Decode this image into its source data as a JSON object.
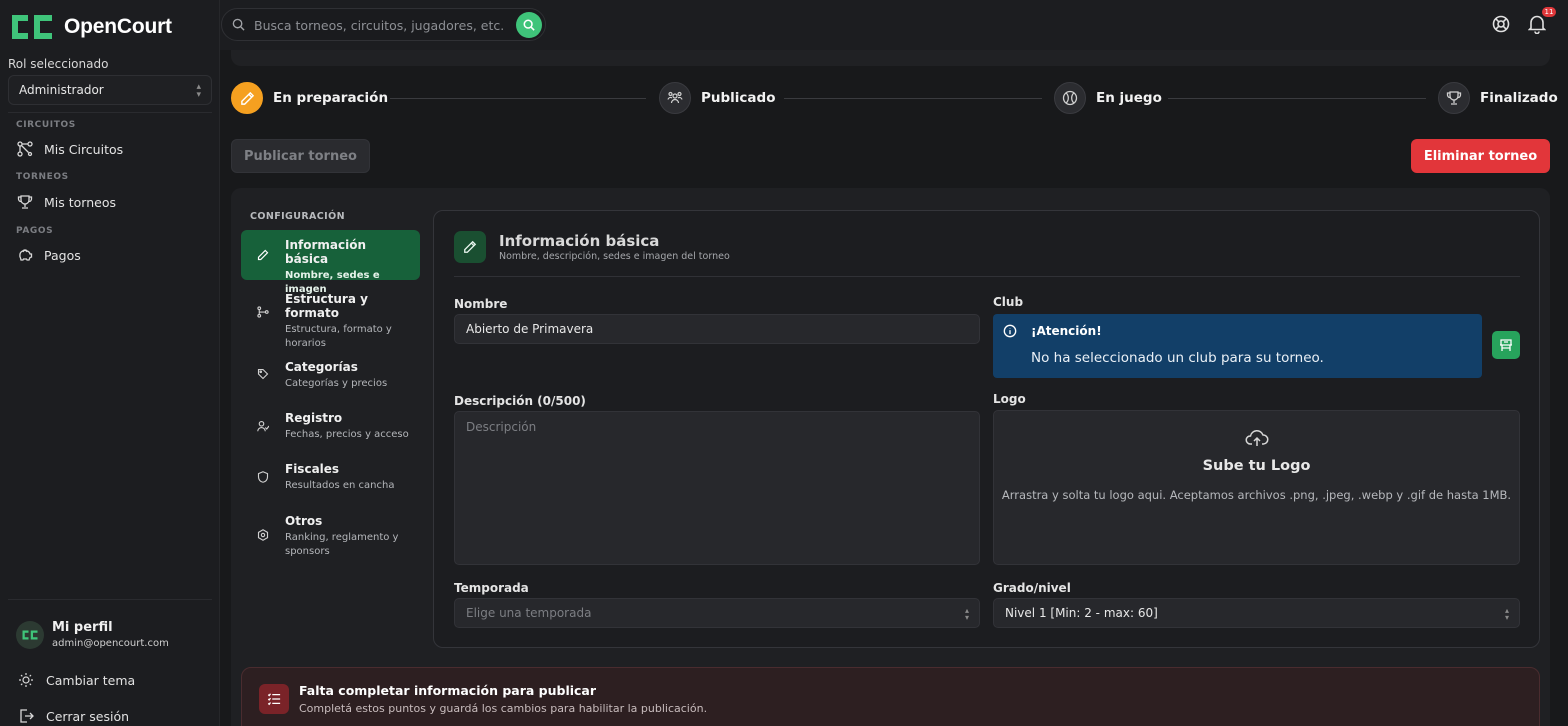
{
  "app": {
    "name": "OpenCourt"
  },
  "sidebar": {
    "role_label": "Rol seleccionado",
    "role_value": "Administrador",
    "sections": [
      {
        "title": "CIRCUITOS",
        "item": "Mis Circuitos",
        "icon": "circuit-icon"
      },
      {
        "title": "TORNEOS",
        "item": "Mis torneos",
        "icon": "trophy-icon"
      },
      {
        "title": "PAGOS",
        "item": "Pagos",
        "icon": "piggy-bank-icon"
      }
    ],
    "profile": {
      "name": "Mi perfil",
      "email": "admin@opencourt.com"
    },
    "change_theme": "Cambiar tema",
    "logout": "Cerrar sesión"
  },
  "topbar": {
    "search_placeholder": "Busca torneos, circuitos, jugadores, etc.",
    "notification_count": "11"
  },
  "steps": [
    {
      "label": "En preparación",
      "icon": "pencil-icon",
      "active": true
    },
    {
      "label": "Publicado",
      "icon": "people-icon",
      "active": false
    },
    {
      "label": "En juego",
      "icon": "ball-icon",
      "active": false
    },
    {
      "label": "Finalizado",
      "icon": "trophy-icon",
      "active": false
    }
  ],
  "actions": {
    "publish": "Publicar torneo",
    "delete": "Eliminar torneo"
  },
  "config": {
    "title": "CONFIGURACIÓN",
    "items": [
      {
        "title": "Información básica",
        "desc": "Nombre, sedes e imagen"
      },
      {
        "title": "Estructura y formato",
        "desc": "Estructura, formato y horarios"
      },
      {
        "title": "Categorías",
        "desc": "Categorías y precios"
      },
      {
        "title": "Registro",
        "desc": "Fechas, precios y acceso"
      },
      {
        "title": "Fiscales",
        "desc": "Resultados en cancha"
      },
      {
        "title": "Otros",
        "desc": "Ranking, reglamento y sponsors"
      }
    ]
  },
  "card": {
    "title": "Información básica",
    "subtitle": "Nombre, descripción, sedes e imagen del torneo",
    "name_label": "Nombre",
    "name_value": "Abierto de Primavera",
    "club_label": "Club",
    "alert_title": "¡Atención!",
    "alert_message": "No ha seleccionado un club para su torneo.",
    "desc_label": "Descripción (0/500)",
    "desc_placeholder": "Descripción",
    "logo_label": "Logo",
    "logo_title": "Sube tu Logo",
    "logo_desc": "Arrastra y solta tu logo aqui. Aceptamos archivos .png, .jpeg, .webp y .gif de hasta 1MB.",
    "season_label": "Temporada",
    "season_placeholder": "Elige una temporada",
    "level_label": "Grado/nivel",
    "level_value": "Nivel 1 [Min: 2 - max: 60]"
  },
  "warning": {
    "title": "Falta completar información para publicar",
    "desc": "Completá estos puntos y guardá los cambios para habilitar la publicación."
  },
  "colors": {
    "accent_green": "#3fc47a",
    "active_orange": "#f5a020",
    "danger_red": "#e2363a",
    "alert_blue": "#123f68"
  }
}
